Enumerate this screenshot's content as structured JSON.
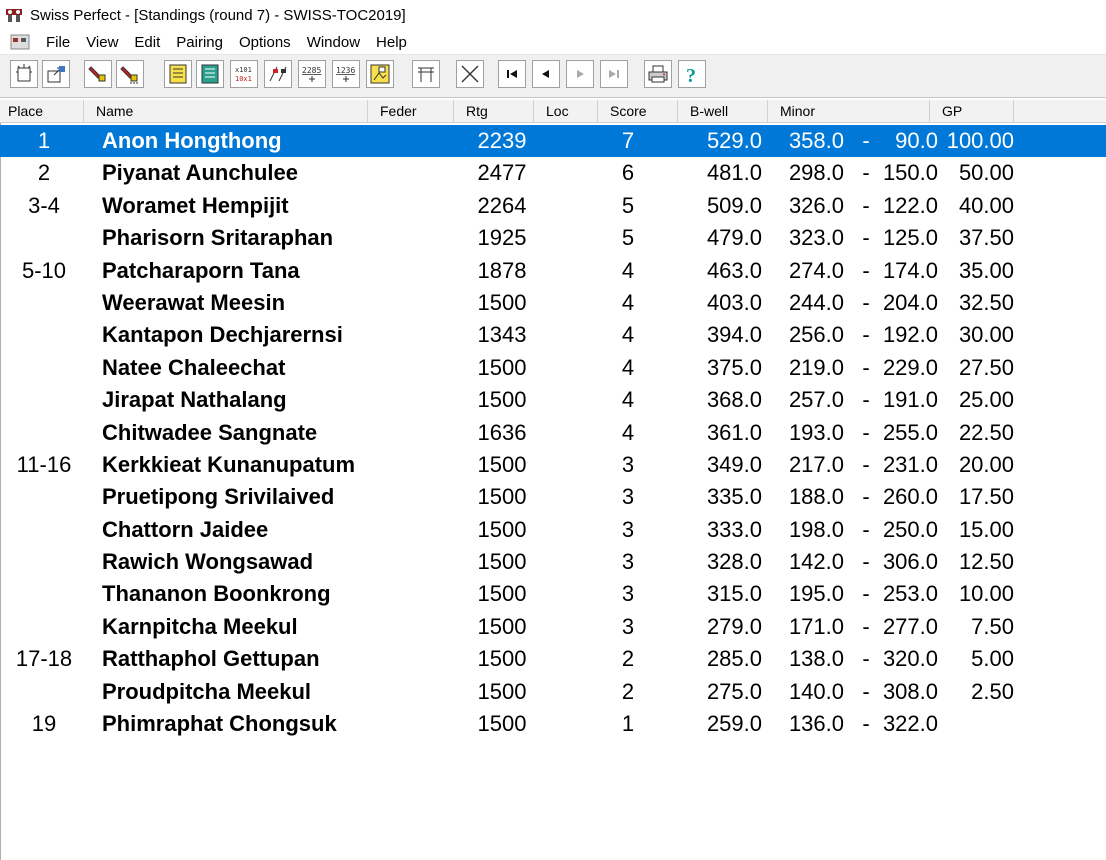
{
  "window": {
    "title": "Swiss Perfect - [Standings  (round 7) - SWISS-TOC2019]"
  },
  "menu": [
    "File",
    "View",
    "Edit",
    "Pairing",
    "Options",
    "Window",
    "Help"
  ],
  "toolbar": {
    "buttons": [
      "new-icon",
      "open-icon",
      "select-tool-icon",
      "select-more-icon",
      "scoresheet-icon",
      "table-list-icon",
      "grid-numbers-icon",
      "pairing-flags-icon",
      "ratings-2285-icon",
      "ratings-1236-icon",
      "picture-icon",
      "table-icon",
      "crossed-swords-icon",
      "first-round-icon",
      "previous-round-icon",
      "next-round-icon",
      "last-round-icon",
      "printer-icon",
      "help-icon"
    ],
    "rating_labels": {
      "a": "2285",
      "b": "1236"
    }
  },
  "columns": [
    "Place",
    "Name",
    "Feder",
    "Rtg",
    "Loc",
    "Score",
    "B-well",
    "Minor",
    "GP"
  ],
  "rows": [
    {
      "place": "1",
      "name": "Anon Hongthong",
      "rtg": "2239",
      "score": "7",
      "bwell": "529.0",
      "minor_a": "358.0",
      "dash": "-",
      "minor_b": "90.0",
      "gp": "100.00"
    },
    {
      "place": "2",
      "name": "Piyanat Aunchulee",
      "rtg": "2477",
      "score": "6",
      "bwell": "481.0",
      "minor_a": "298.0",
      "dash": "-",
      "minor_b": "150.0",
      "gp": "50.00"
    },
    {
      "place": "3-4",
      "name": "Woramet Hempijit",
      "rtg": "2264",
      "score": "5",
      "bwell": "509.0",
      "minor_a": "326.0",
      "dash": "-",
      "minor_b": "122.0",
      "gp": "40.00"
    },
    {
      "place": "",
      "name": "Pharisorn Sritaraphan",
      "rtg": "1925",
      "score": "5",
      "bwell": "479.0",
      "minor_a": "323.0",
      "dash": "-",
      "minor_b": "125.0",
      "gp": "37.50"
    },
    {
      "place": "5-10",
      "name": "Patcharaporn Tana",
      "rtg": "1878",
      "score": "4",
      "bwell": "463.0",
      "minor_a": "274.0",
      "dash": "-",
      "minor_b": "174.0",
      "gp": "35.00"
    },
    {
      "place": "",
      "name": "Weerawat Meesin",
      "rtg": "1500",
      "score": "4",
      "bwell": "403.0",
      "minor_a": "244.0",
      "dash": "-",
      "minor_b": "204.0",
      "gp": "32.50"
    },
    {
      "place": "",
      "name": "Kantapon Dechjarernsi",
      "rtg": "1343",
      "score": "4",
      "bwell": "394.0",
      "minor_a": "256.0",
      "dash": "-",
      "minor_b": "192.0",
      "gp": "30.00"
    },
    {
      "place": "",
      "name": "Natee Chaleechat",
      "rtg": "1500",
      "score": "4",
      "bwell": "375.0",
      "minor_a": "219.0",
      "dash": "-",
      "minor_b": "229.0",
      "gp": "27.50"
    },
    {
      "place": "",
      "name": "Jirapat Nathalang",
      "rtg": "1500",
      "score": "4",
      "bwell": "368.0",
      "minor_a": "257.0",
      "dash": "-",
      "minor_b": "191.0",
      "gp": "25.00"
    },
    {
      "place": "",
      "name": "Chitwadee Sangnate",
      "rtg": "1636",
      "score": "4",
      "bwell": "361.0",
      "minor_a": "193.0",
      "dash": "-",
      "minor_b": "255.0",
      "gp": "22.50"
    },
    {
      "place": "11-16",
      "name": "Kerkkieat Kunanupatum",
      "rtg": "1500",
      "score": "3",
      "bwell": "349.0",
      "minor_a": "217.0",
      "dash": "-",
      "minor_b": "231.0",
      "gp": "20.00"
    },
    {
      "place": "",
      "name": "Pruetipong Srivilaived",
      "rtg": "1500",
      "score": "3",
      "bwell": "335.0",
      "minor_a": "188.0",
      "dash": "-",
      "minor_b": "260.0",
      "gp": "17.50"
    },
    {
      "place": "",
      "name": "Chattorn Jaidee",
      "rtg": "1500",
      "score": "3",
      "bwell": "333.0",
      "minor_a": "198.0",
      "dash": "-",
      "minor_b": "250.0",
      "gp": "15.00"
    },
    {
      "place": "",
      "name": "Rawich Wongsawad",
      "rtg": "1500",
      "score": "3",
      "bwell": "328.0",
      "minor_a": "142.0",
      "dash": "-",
      "minor_b": "306.0",
      "gp": "12.50"
    },
    {
      "place": "",
      "name": "Thananon Boonkrong",
      "rtg": "1500",
      "score": "3",
      "bwell": "315.0",
      "minor_a": "195.0",
      "dash": "-",
      "minor_b": "253.0",
      "gp": "10.00"
    },
    {
      "place": "",
      "name": "Karnpitcha Meekul",
      "rtg": "1500",
      "score": "3",
      "bwell": "279.0",
      "minor_a": "171.0",
      "dash": "-",
      "minor_b": "277.0",
      "gp": "7.50"
    },
    {
      "place": "17-18",
      "name": "Ratthaphol Gettupan",
      "rtg": "1500",
      "score": "2",
      "bwell": "285.0",
      "minor_a": "138.0",
      "dash": "-",
      "minor_b": "320.0",
      "gp": "5.00"
    },
    {
      "place": "",
      "name": "Proudpitcha Meekul",
      "rtg": "1500",
      "score": "2",
      "bwell": "275.0",
      "minor_a": "140.0",
      "dash": "-",
      "minor_b": "308.0",
      "gp": "2.50"
    },
    {
      "place": "19",
      "name": "Phimraphat Chongsuk",
      "rtg": "1500",
      "score": "1",
      "bwell": "259.0",
      "minor_a": "136.0",
      "dash": "-",
      "minor_b": "322.0",
      "gp": ""
    }
  ],
  "colors": {
    "selection": "#0078d7",
    "header_bg": "#f2f2f2",
    "toolbar_bg": "#f0f0f0"
  }
}
